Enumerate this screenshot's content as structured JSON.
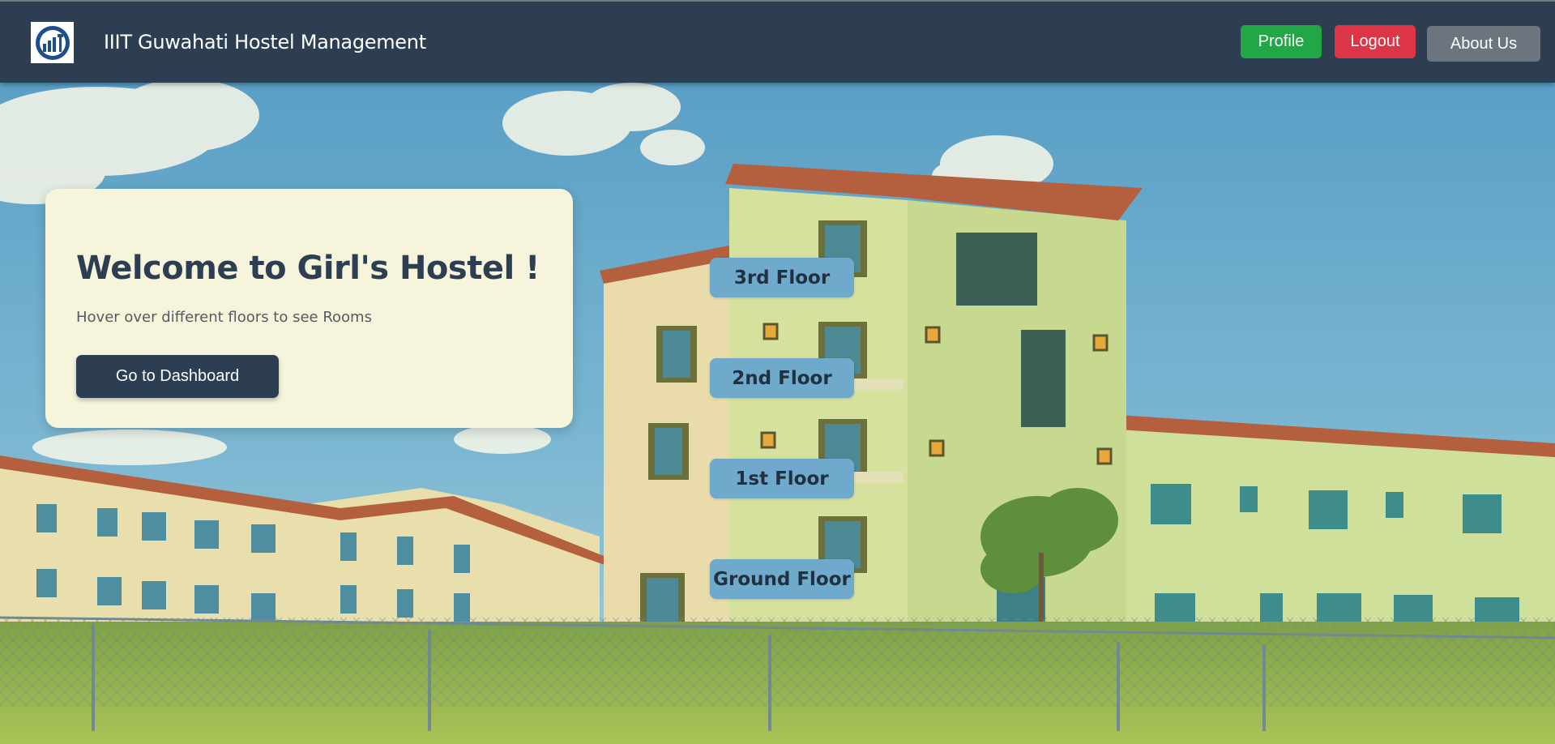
{
  "navbar": {
    "logo_icon": "iiitg-logo-icon",
    "brand": "IIIT Guwahati Hostel Management",
    "buttons": {
      "profile": "Profile",
      "logout": "Logout",
      "about": "About Us"
    },
    "colors": {
      "bar": "#2d3e52",
      "profile": "#22a746",
      "logout": "#dc3545",
      "about": "#6c757d"
    }
  },
  "hero": {
    "background": "hostel-building-illustration",
    "card": {
      "title": "Welcome to Girl's Hostel !",
      "subtitle": "Hover over different floors to see Rooms",
      "dashboard_button": "Go to Dashboard"
    },
    "floors": [
      "3rd Floor",
      "2nd Floor",
      "1st Floor",
      "Ground Floor"
    ]
  }
}
